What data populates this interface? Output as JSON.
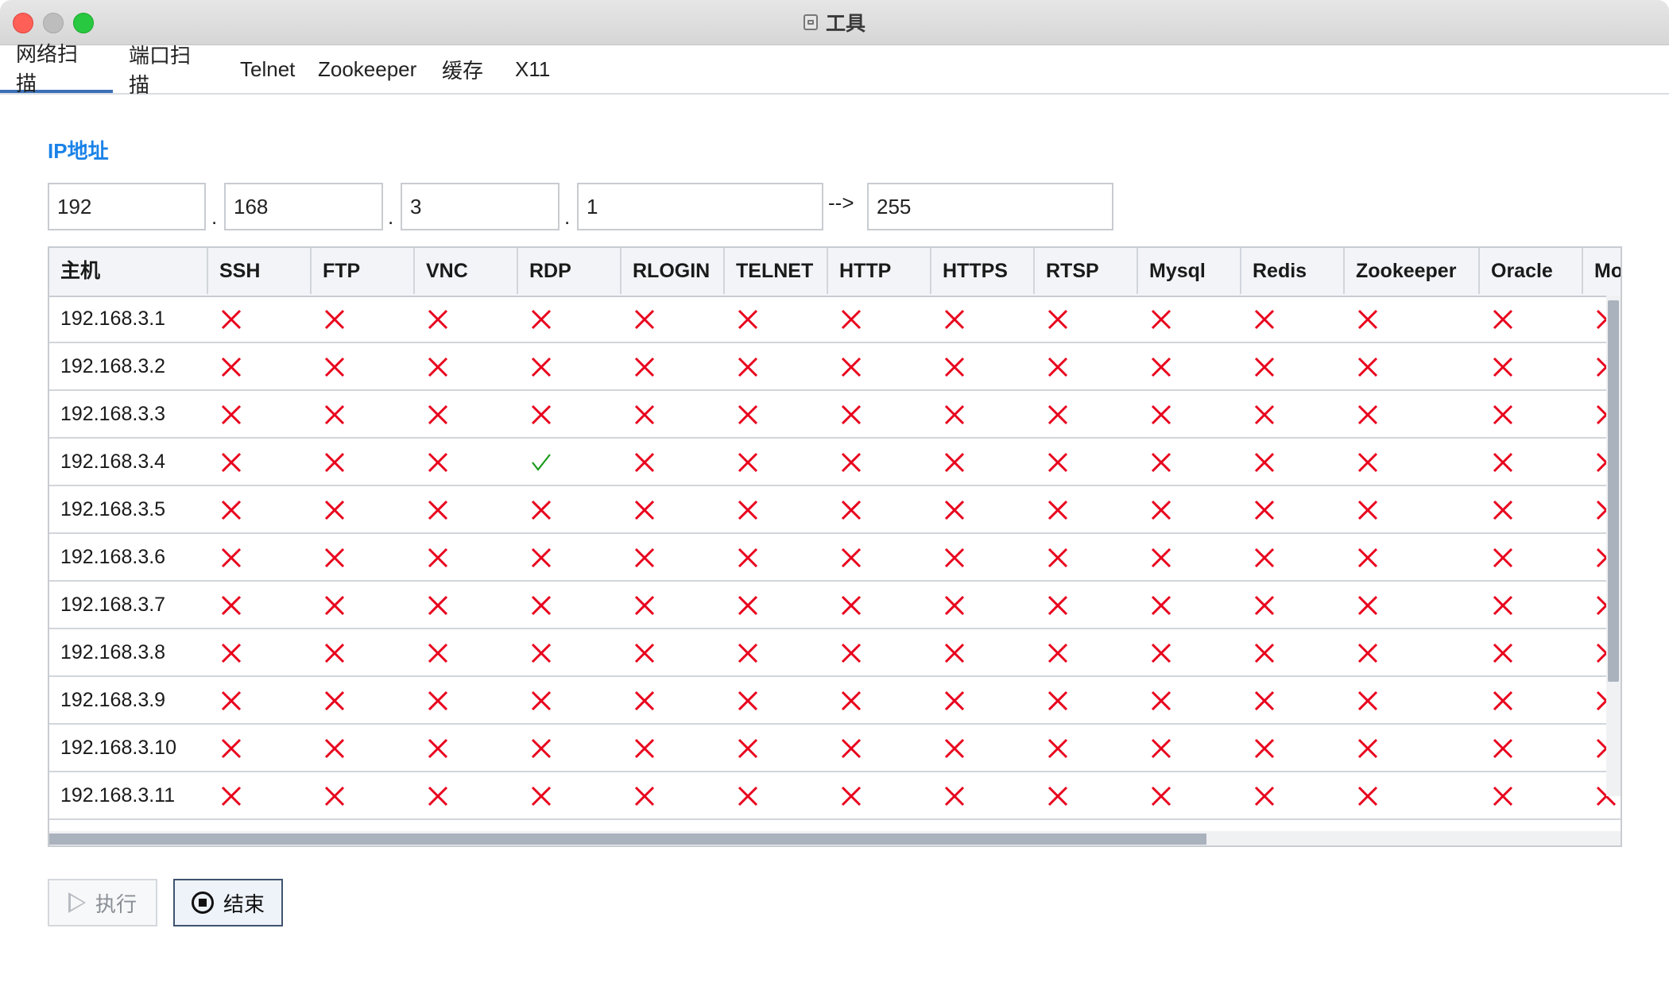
{
  "window": {
    "title": "工具"
  },
  "tabs": [
    {
      "label": "网络扫描",
      "active": true
    },
    {
      "label": "端口扫描",
      "active": false
    },
    {
      "label": "Telnet",
      "active": false
    },
    {
      "label": "Zookeeper",
      "active": false
    },
    {
      "label": "缓存",
      "active": false
    },
    {
      "label": "X11",
      "active": false
    }
  ],
  "ip": {
    "label": "IP地址",
    "octet1": "192",
    "octet2": "168",
    "octet3": "3",
    "octet4": "1",
    "end": "255",
    "dot": ".",
    "arrow": "-->"
  },
  "table": {
    "columns": [
      "主机",
      "SSH",
      "FTP",
      "VNC",
      "RDP",
      "RLOGIN",
      "TELNET",
      "HTTP",
      "HTTPS",
      "RTSP",
      "Mysql",
      "Redis",
      "Zookeeper",
      "Oracle",
      "Mongo"
    ],
    "rows": [
      {
        "host": "192.168.3.1",
        "results": [
          false,
          false,
          false,
          false,
          false,
          false,
          false,
          false,
          false,
          false,
          false,
          false,
          false,
          false
        ]
      },
      {
        "host": "192.168.3.2",
        "results": [
          false,
          false,
          false,
          false,
          false,
          false,
          false,
          false,
          false,
          false,
          false,
          false,
          false,
          false
        ]
      },
      {
        "host": "192.168.3.3",
        "results": [
          false,
          false,
          false,
          false,
          false,
          false,
          false,
          false,
          false,
          false,
          false,
          false,
          false,
          false
        ]
      },
      {
        "host": "192.168.3.4",
        "results": [
          false,
          false,
          false,
          true,
          false,
          false,
          false,
          false,
          false,
          false,
          false,
          false,
          false,
          false
        ]
      },
      {
        "host": "192.168.3.5",
        "results": [
          false,
          false,
          false,
          false,
          false,
          false,
          false,
          false,
          false,
          false,
          false,
          false,
          false,
          false
        ]
      },
      {
        "host": "192.168.3.6",
        "results": [
          false,
          false,
          false,
          false,
          false,
          false,
          false,
          false,
          false,
          false,
          false,
          false,
          false,
          false
        ]
      },
      {
        "host": "192.168.3.7",
        "results": [
          false,
          false,
          false,
          false,
          false,
          false,
          false,
          false,
          false,
          false,
          false,
          false,
          false,
          false
        ]
      },
      {
        "host": "192.168.3.8",
        "results": [
          false,
          false,
          false,
          false,
          false,
          false,
          false,
          false,
          false,
          false,
          false,
          false,
          false,
          false
        ]
      },
      {
        "host": "192.168.3.9",
        "results": [
          false,
          false,
          false,
          false,
          false,
          false,
          false,
          false,
          false,
          false,
          false,
          false,
          false,
          false
        ]
      },
      {
        "host": "192.168.3.10",
        "results": [
          false,
          false,
          false,
          false,
          false,
          false,
          false,
          false,
          false,
          false,
          false,
          false,
          false,
          false
        ]
      },
      {
        "host": "192.168.3.11",
        "results": [
          false,
          false,
          false,
          false,
          false,
          false,
          false,
          false,
          false,
          false,
          false,
          false,
          false,
          false
        ]
      }
    ]
  },
  "buttons": {
    "run_label": "执行",
    "stop_label": "结束"
  },
  "colors": {
    "accent": "#1a82e8",
    "fail": "#e8001c",
    "success": "#1a9a1a"
  },
  "icons": {
    "fail": "x-mark-icon",
    "success": "check-mark-icon",
    "run": "play-icon",
    "stop": "stop-circle-icon"
  }
}
